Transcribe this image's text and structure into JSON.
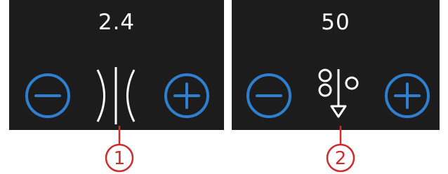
{
  "panels": [
    {
      "value": "2.4",
      "icon": "stitch-width-icon",
      "callout_number": "1"
    },
    {
      "value": "50",
      "icon": "stitch-density-icon",
      "callout_number": "2"
    }
  ],
  "colors": {
    "panel_bg": "#1c1c1c",
    "button_blue": "#2f7fd1",
    "text": "#ffffff",
    "callout_red": "#d12a2a"
  }
}
